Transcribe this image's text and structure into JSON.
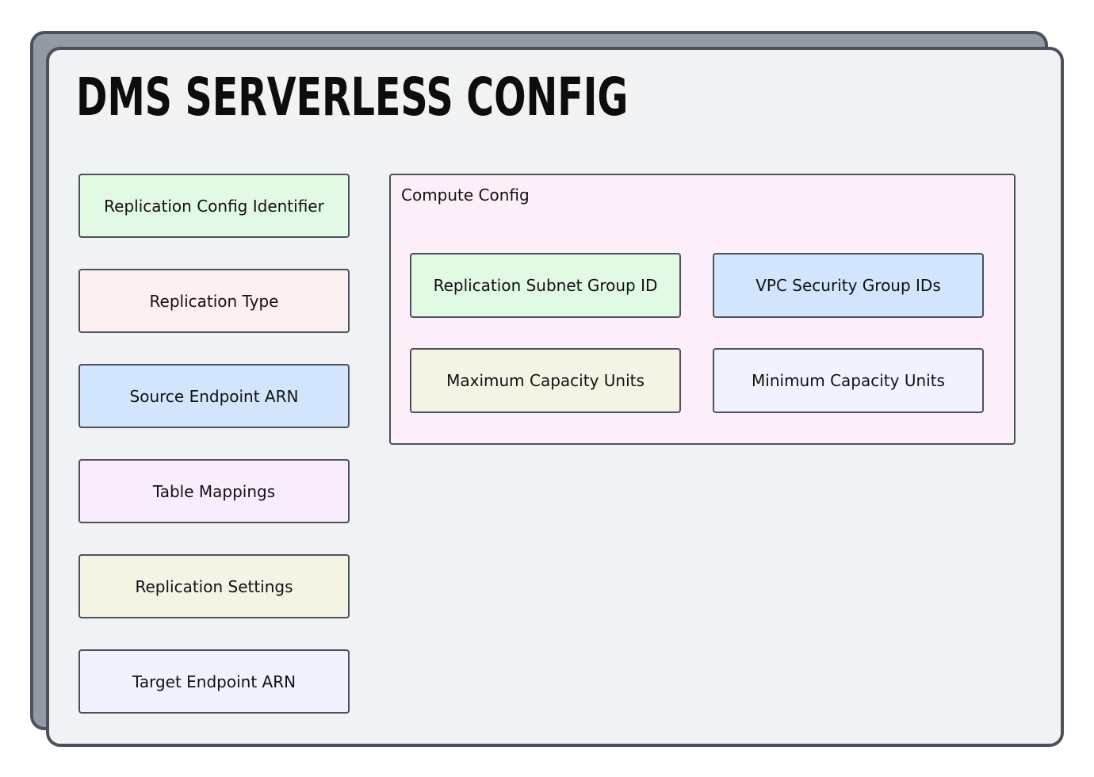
{
  "title": "DMS SERVERLESS CONFIG",
  "fields": [
    {
      "label": "Replication Config Identifier",
      "color": "#e2f9e4"
    },
    {
      "label": "Replication Type",
      "color": "#fdf0f0"
    },
    {
      "label": "Source Endpoint ARN",
      "color": "#d2e5fd"
    },
    {
      "label": "Table Mappings",
      "color": "#f9edfd"
    },
    {
      "label": "Replication Settings",
      "color": "#f5f3e3"
    },
    {
      "label": "Target Endpoint ARN",
      "color": "#f0f2fd"
    }
  ],
  "compute_config": {
    "label": "Compute Config",
    "color": "#fdeffa",
    "items": [
      {
        "label": "Replication Subnet Group ID",
        "color": "#e2f9e4"
      },
      {
        "label": "VPC Security Group IDs",
        "color": "#d2e5fd"
      },
      {
        "label": "Maximum Capacity Units",
        "color": "#f5f3e3"
      },
      {
        "label": "Minimum Capacity Units",
        "color": "#f0f2fd"
      }
    ]
  }
}
